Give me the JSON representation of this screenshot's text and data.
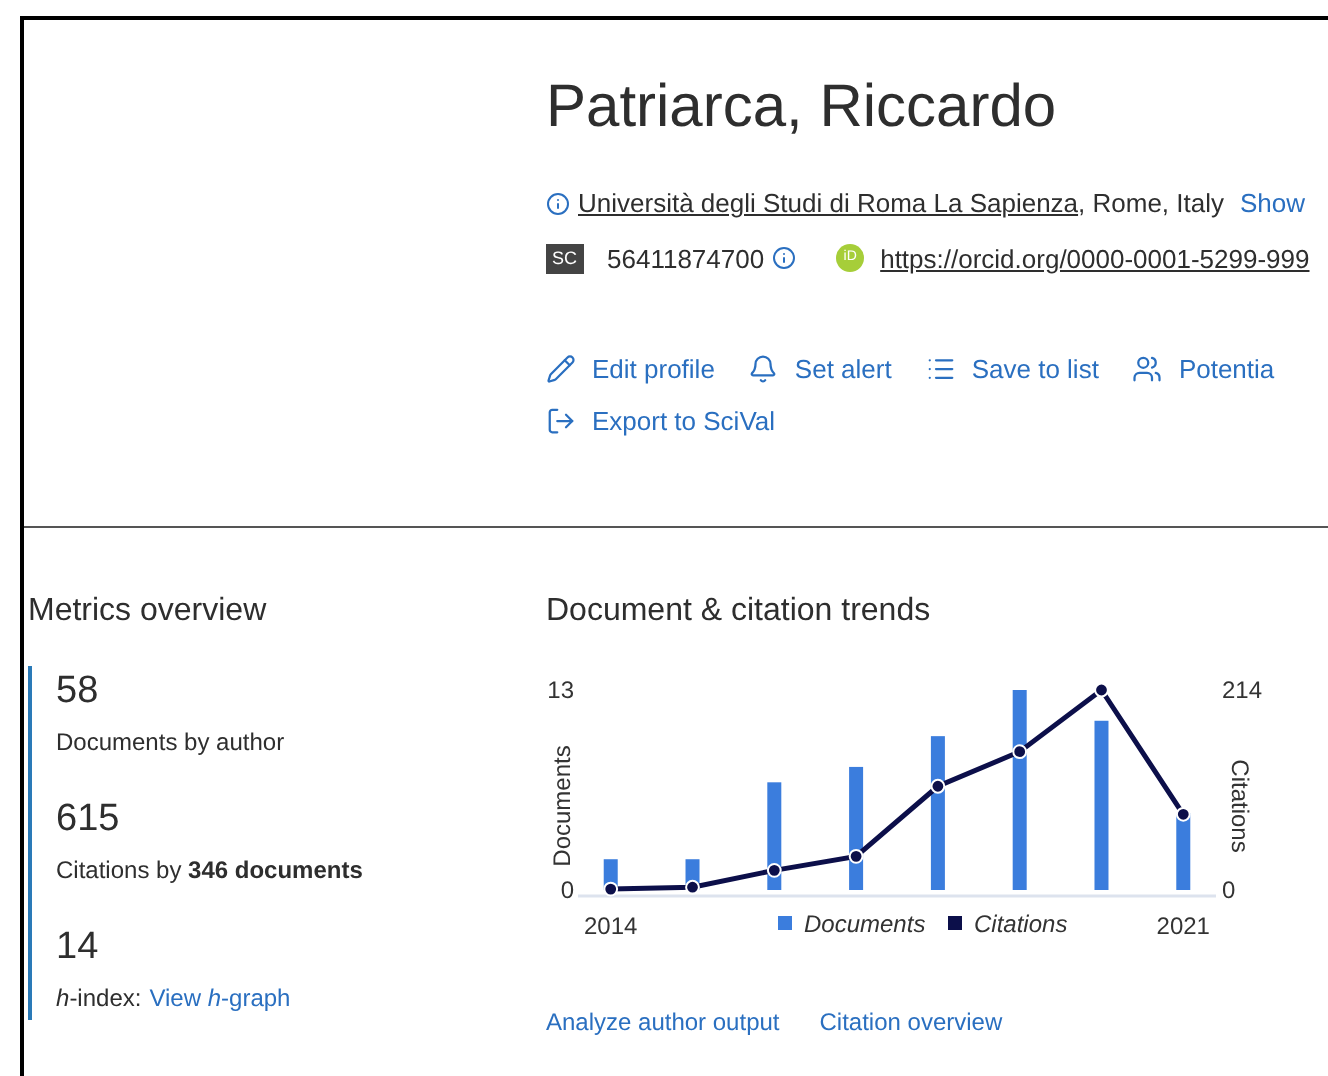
{
  "profile": {
    "name": "Patriarca, Riccardo",
    "affiliation": {
      "link": "Università degli Studi di Roma La Sapienza",
      "rest": ", Rome, Italy"
    },
    "show_link": "Show",
    "scopus_badge": "SC",
    "author_id": "56411874700",
    "orcid_badge": "iD",
    "orcid_url": "https://orcid.org/0000-0001-5299-999",
    "actions": [
      {
        "kind": "edit",
        "label": "Edit profile"
      },
      {
        "kind": "alert",
        "label": "Set alert"
      },
      {
        "kind": "list",
        "label": "Save to list"
      },
      {
        "kind": "people",
        "label": "Potentia"
      },
      {
        "kind": "export",
        "label": "Export to SciVal"
      }
    ]
  },
  "metrics": {
    "title": "Metrics overview",
    "items": [
      {
        "value": "58",
        "label": "Documents by author"
      },
      {
        "value": "615",
        "label": "Citations by **346 documents**"
      },
      {
        "value": "14",
        "label": "*h*-index:",
        "link": "View *h*-graph"
      }
    ]
  },
  "trends": {
    "title": "Document & citation trends",
    "chart_data": {
      "type": "bar",
      "ylabel": "Documents",
      "y2label": "Citations",
      "x": [
        2014,
        2015,
        2016,
        2017,
        2018,
        2019,
        2020,
        2021
      ],
      "legend": true,
      "series": [
        {
          "name": "Documents",
          "color": "#3b7ddd",
          "type": "bar",
          "values": [
            2,
            2,
            7,
            8,
            10,
            13,
            11,
            5
          ]
        },
        {
          "name": "Citations",
          "color": "#0c0f4a",
          "type": "line",
          "axis": "y2",
          "marker": "circle",
          "values": [
            1,
            3,
            21,
            36,
            111,
            148,
            214,
            81
          ]
        }
      ],
      "xlim": [
        2013.6,
        2021.4
      ],
      "xticks": [
        2014,
        2021
      ],
      "ylim": [
        0,
        13
      ],
      "yticks": [
        0,
        13
      ],
      "y2lim": [
        0,
        214
      ],
      "y2ticks": [
        0,
        214
      ]
    },
    "links": [
      "Analyze author output",
      "Citation overview"
    ]
  }
}
